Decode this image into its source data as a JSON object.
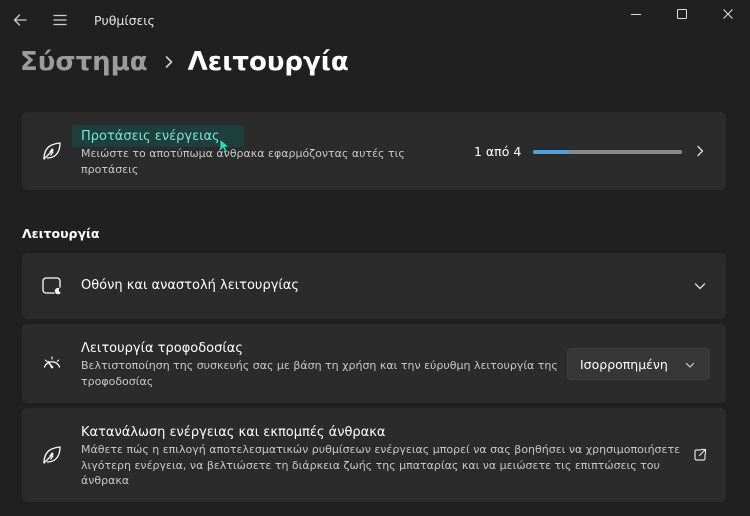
{
  "titlebar": {
    "app_title": "Ρυθμίσεις",
    "back_icon": "back-arrow-icon",
    "menu_icon": "hamburger-menu-icon"
  },
  "breadcrumb": {
    "parent": "Σύστημα",
    "current": "Λειτουργία"
  },
  "recommendations": {
    "title": "Προτάσεις ενέργειας",
    "description": "Μειώστε το αποτύπωμα άνθρακα εφαρμόζοντας αυτές τις προτάσεις",
    "progress_text": "1 από 4",
    "progress_fraction": 0.25,
    "icon": "leaf-energy-icon"
  },
  "section": {
    "header": "Λειτουργία"
  },
  "screen_sleep": {
    "title": "Οθόνη και αναστολή λειτουργίας",
    "icon": "screen-sleep-icon"
  },
  "power_mode": {
    "title": "Λειτουργία τροφοδοσίας",
    "description": "Βελτιστοποίηση της συσκευής σας με βάση τη χρήση και την εύρυθμη λειτουργία της τροφοδοσίας",
    "selected": "Ισορροπημένη",
    "icon": "gauge-icon"
  },
  "energy_consumption": {
    "title": "Κατανάλωση ενέργειας και εκπομπές άνθρακα",
    "description": "Μάθετε πώς η επιλογή αποτελεσματικών ρυθμίσεων ενέργειας μπορεί να σας βοηθήσει να χρησιμοποιήσετε λιγότερη ενέργεια, να βελτιώσετε τη διάρκεια ζωής της μπαταρίας και να μειώσετε τις επιπτώσεις του άνθρακα",
    "icon": "leaf-energy-icon"
  },
  "colors": {
    "background": "#202020",
    "card": "#2b2b2b",
    "accent": "#4ca0e0",
    "highlight": "#1e3f3c",
    "highlight_text": "#7fe5d5"
  }
}
